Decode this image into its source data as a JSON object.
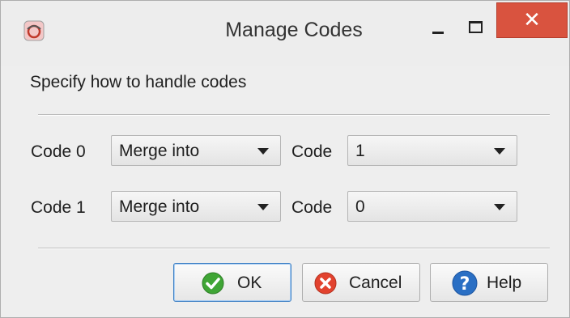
{
  "window": {
    "title": "Manage Codes",
    "icon": "app-logo-icon",
    "controls": {
      "minimize": "minimize-icon",
      "maximize": "maximize-icon",
      "close": "close-icon"
    }
  },
  "dialog": {
    "instruction": "Specify how to handle codes",
    "rows": [
      {
        "label": "Code 0",
        "action": "Merge into",
        "target_label": "Code",
        "target": "1"
      },
      {
        "label": "Code 1",
        "action": "Merge into",
        "target_label": "Code",
        "target": "0"
      }
    ]
  },
  "buttons": {
    "ok": {
      "label": "OK",
      "icon": "check-icon"
    },
    "cancel": {
      "label": "Cancel",
      "icon": "cancel-x-icon"
    },
    "help": {
      "label": "Help",
      "icon": "question-icon"
    }
  },
  "colors": {
    "close_button": "#d9533f",
    "ok_icon": "#3fa535",
    "cancel_icon": "#e2422e",
    "help_icon": "#2a6fc4",
    "default_button_border": "#3c7fc4"
  }
}
